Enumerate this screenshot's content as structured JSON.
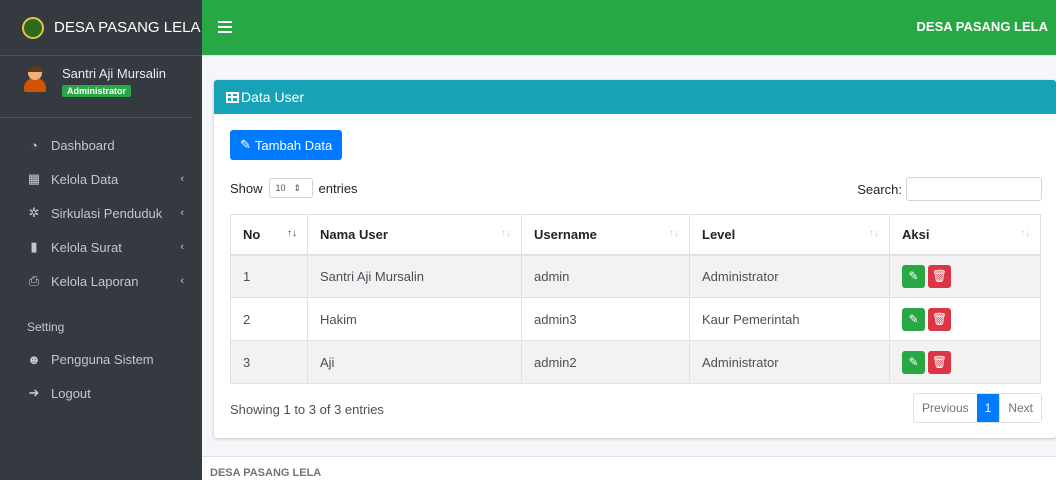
{
  "brand": {
    "title": "DESA PASANG LELA"
  },
  "user": {
    "name": "Santri Aji Mursalin",
    "role": "Administrator"
  },
  "sidebar": {
    "items": [
      {
        "label": "Dashboard",
        "icon": "dashboard-icon",
        "glyph": "◔"
      },
      {
        "label": "Kelola Data",
        "icon": "table-icon",
        "glyph": "▦",
        "chevron": "‹"
      },
      {
        "label": "Sirkulasi Penduduk",
        "icon": "cogs-icon",
        "glyph": "✲",
        "chevron": "‹"
      },
      {
        "label": "Kelola Surat",
        "icon": "file-icon",
        "glyph": "▮",
        "chevron": "‹"
      },
      {
        "label": "Kelola Laporan",
        "icon": "print-icon",
        "glyph": "⎙",
        "chevron": "‹"
      }
    ],
    "setting_header": "Setting",
    "setting_items": [
      {
        "label": "Pengguna Sistem",
        "icon": "user-icon",
        "glyph": "☻"
      },
      {
        "label": "Logout",
        "icon": "logout-icon",
        "glyph": "➜"
      }
    ]
  },
  "topbar": {
    "title": "DESA PASANG LELA"
  },
  "card": {
    "title": "Data User",
    "add_button": "Tambah Data",
    "show_label": "Show",
    "entries_value": "10",
    "entries_label": "entries",
    "search_label": "Search:",
    "columns": [
      "No",
      "Nama User",
      "Username",
      "Level",
      "Aksi"
    ],
    "rows": [
      {
        "no": "1",
        "nama": "Santri Aji Mursalin",
        "username": "admin",
        "level": "Administrator"
      },
      {
        "no": "2",
        "nama": "Hakim",
        "username": "admin3",
        "level": "Kaur Pemerintah"
      },
      {
        "no": "3",
        "nama": "Aji",
        "username": "admin2",
        "level": "Administrator"
      }
    ],
    "info": "Showing 1 to 3 of 3 entries",
    "pagination": {
      "previous": "Previous",
      "current": "1",
      "next": "Next"
    }
  },
  "footer": {
    "text": "DESA PASANG LELA"
  },
  "colors": {
    "sidebar": "#343a40",
    "topbar": "#28a745",
    "card_header": "#17a2b8",
    "primary": "#007bff",
    "danger": "#dc3545",
    "success": "#28a745"
  }
}
